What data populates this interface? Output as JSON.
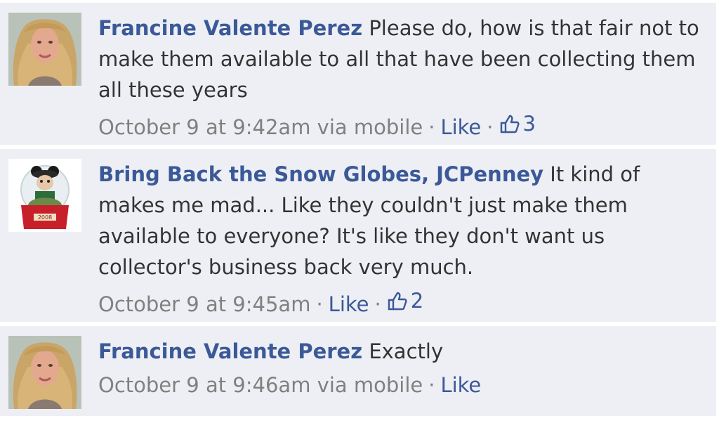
{
  "comments": [
    {
      "author": "Francine Valente Perez",
      "text": "Please do, how is that fair not to make them available to all that have been collecting them all these years",
      "timestamp": "October 9 at 9:42am via mobile",
      "like_label": "Like",
      "like_count": "3",
      "avatar_icon": "woman-profile-photo"
    },
    {
      "author": "Bring Back the Snow Globes, JCPenney",
      "text": "It kind of makes me mad... Like they couldn't just make them available to everyone? It's like they don't want us collector's business back very much.",
      "timestamp": "October 9 at 9:45am",
      "like_label": "Like",
      "like_count": "2",
      "avatar_icon": "snow-globe-photo"
    },
    {
      "author": "Francine Valente Perez",
      "text": "Exactly",
      "timestamp": "October 9 at 9:46am via mobile",
      "like_label": "Like",
      "avatar_icon": "woman-profile-photo"
    }
  ],
  "colors": {
    "link": "#3b5998",
    "background": "#edeff4",
    "meta": "#808080",
    "text": "#333333"
  }
}
